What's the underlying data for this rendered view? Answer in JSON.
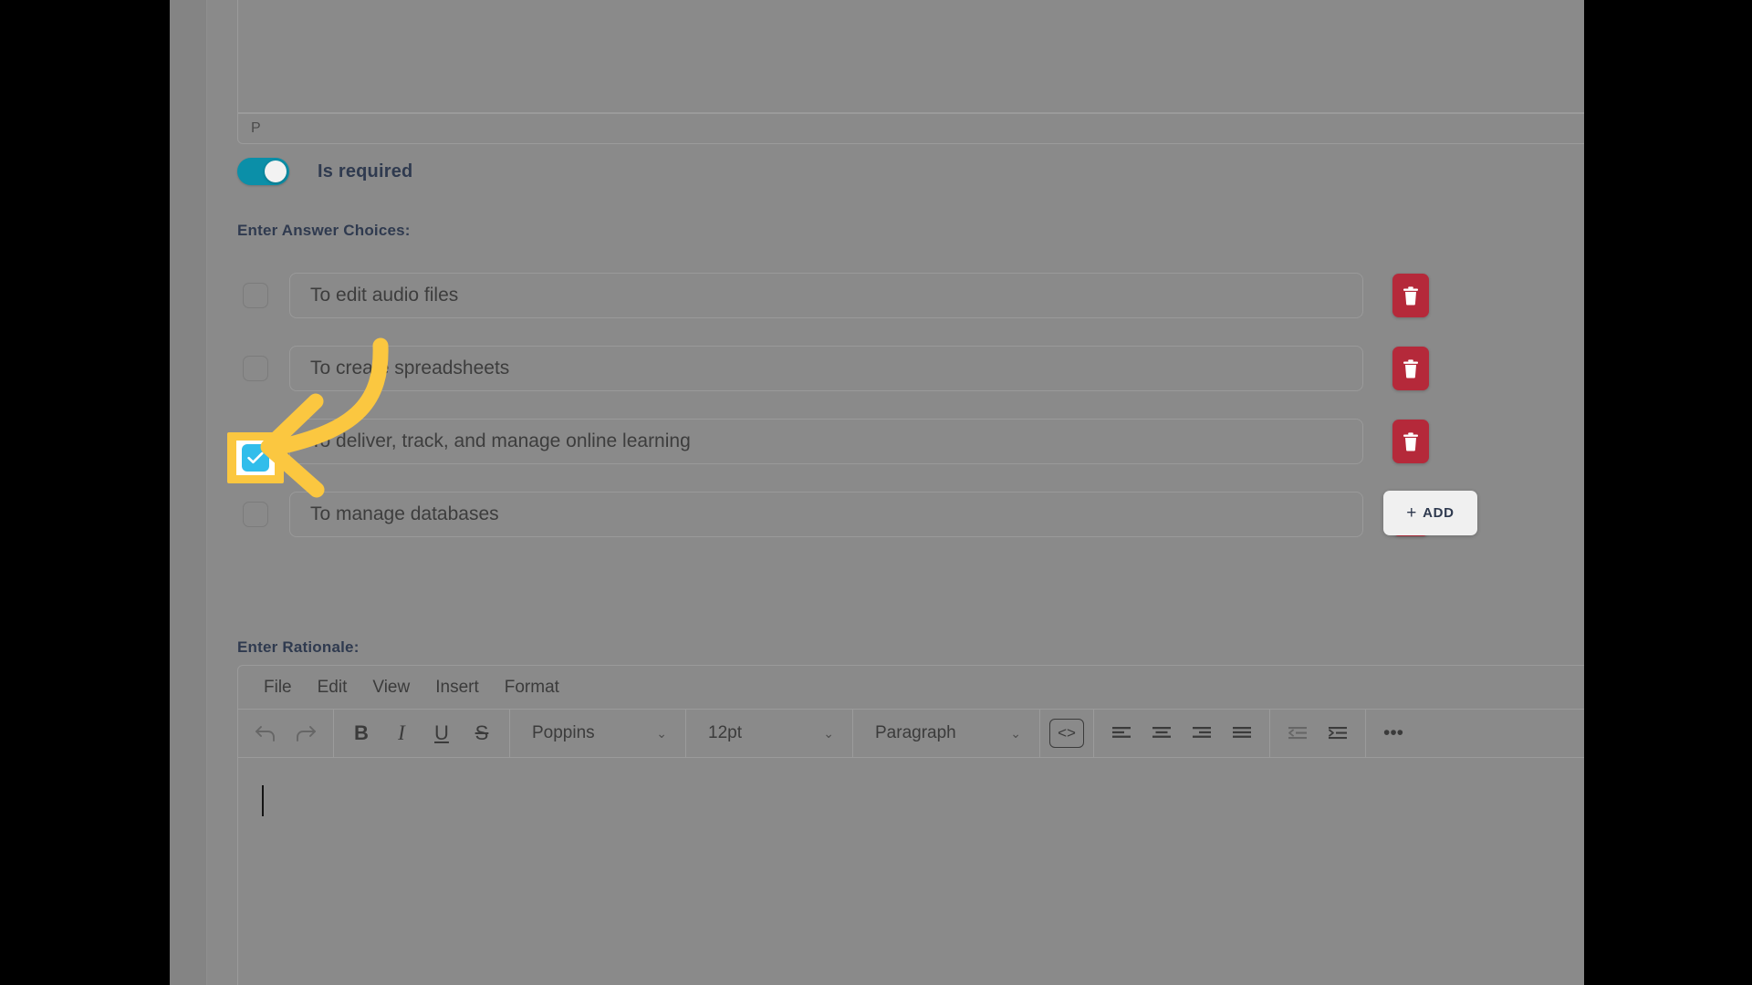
{
  "theme": {
    "accent_teal": "#0b8fa8",
    "checkbox_checked": "#31bdeb",
    "delete_red": "#b5293a",
    "highlight_yellow": "#fbc740",
    "label_navy": "#2f3a4f",
    "page_dim": "#8a8a8a"
  },
  "status_bar": {
    "path": "P"
  },
  "required_toggle": {
    "label": "Is required",
    "state": "on"
  },
  "labels": {
    "answer_choices": "Enter Answer Choices:",
    "rationale": "Enter Rationale:"
  },
  "answer_choices": {
    "add_button": {
      "plus": "+",
      "label": "ADD"
    },
    "items": [
      {
        "text": "To edit audio files",
        "checked": false,
        "highlighted": false,
        "delete_icon": "trash-icon"
      },
      {
        "text": "To create spreadsheets",
        "checked": false,
        "highlighted": false,
        "delete_icon": "trash-icon"
      },
      {
        "text": "To deliver, track, and manage online learning",
        "checked": true,
        "highlighted": true,
        "delete_icon": "trash-icon"
      },
      {
        "text": "To manage databases",
        "checked": false,
        "highlighted": false,
        "delete_icon": "trash-icon"
      }
    ]
  },
  "rationale_editor": {
    "menu": [
      "File",
      "Edit",
      "View",
      "Insert",
      "Format"
    ],
    "toolbar": {
      "history": [
        {
          "name": "undo-icon",
          "glyph": "↶"
        },
        {
          "name": "redo-icon",
          "glyph": "↷"
        }
      ],
      "inline": [
        {
          "name": "bold-button",
          "glyph": "B"
        },
        {
          "name": "italic-button",
          "glyph": "I"
        },
        {
          "name": "underline-button",
          "glyph": "U"
        },
        {
          "name": "strikethrough-button",
          "glyph": "S"
        }
      ],
      "font_family": {
        "value": "Poppins",
        "chevron": "⌄"
      },
      "font_size": {
        "value": "12pt",
        "chevron": "⌄"
      },
      "block_format": {
        "value": "Paragraph",
        "chevron": "⌄"
      },
      "source_code": {
        "name": "source-code-button",
        "glyph": "<>"
      },
      "align": [
        {
          "name": "align-left-button"
        },
        {
          "name": "align-center-button"
        },
        {
          "name": "align-right-button"
        },
        {
          "name": "align-justify-button"
        }
      ],
      "indent": [
        {
          "name": "outdent-button"
        },
        {
          "name": "indent-button"
        }
      ],
      "overflow": {
        "name": "more-options-button",
        "glyph": "•••"
      }
    },
    "body_text": "",
    "caret_visible": true
  },
  "annotation": {
    "type": "curved-arrow",
    "color": "#fbc740",
    "points_to": "answer-choice-3-checkbox",
    "highlight_target": "answer-choice-3-checkbox"
  }
}
